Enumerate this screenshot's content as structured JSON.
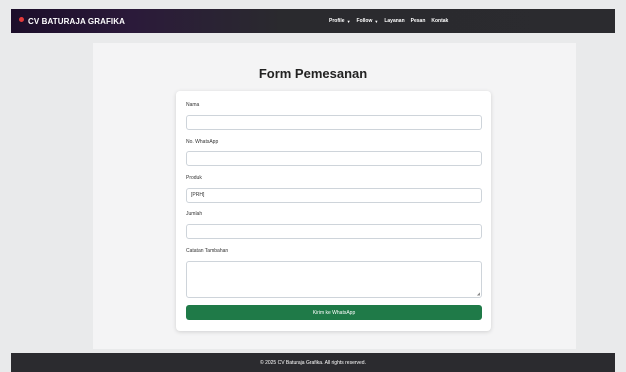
{
  "navbar": {
    "brand": "CV BATURAJA GRAFIKA",
    "items": [
      {
        "label": "Profile",
        "dropdown": true
      },
      {
        "label": "Follow",
        "dropdown": true
      },
      {
        "label": "Layanan",
        "dropdown": false
      },
      {
        "label": "Pesan",
        "dropdown": false
      },
      {
        "label": "Kontak",
        "dropdown": false
      }
    ]
  },
  "form": {
    "title": "Form Pemesanan",
    "fields": {
      "nama": {
        "label": "Nama",
        "value": ""
      },
      "whatsapp": {
        "label": "No. WhatsApp",
        "value": ""
      },
      "produk": {
        "label": "Produk",
        "value": "[PRH]"
      },
      "jumlah": {
        "label": "Jumlah",
        "value": ""
      },
      "catatan": {
        "label": "Catatan Tambahan",
        "value": ""
      }
    },
    "submit_label": "Kirim ke WhatsApp"
  },
  "footer": {
    "text": "© 2025 CV Baturaja Grafika. All rights reserved."
  },
  "colors": {
    "primary_button": "#1f7a48",
    "navbar": "#2b2b2f",
    "brand_icon": "#e23a3a"
  }
}
